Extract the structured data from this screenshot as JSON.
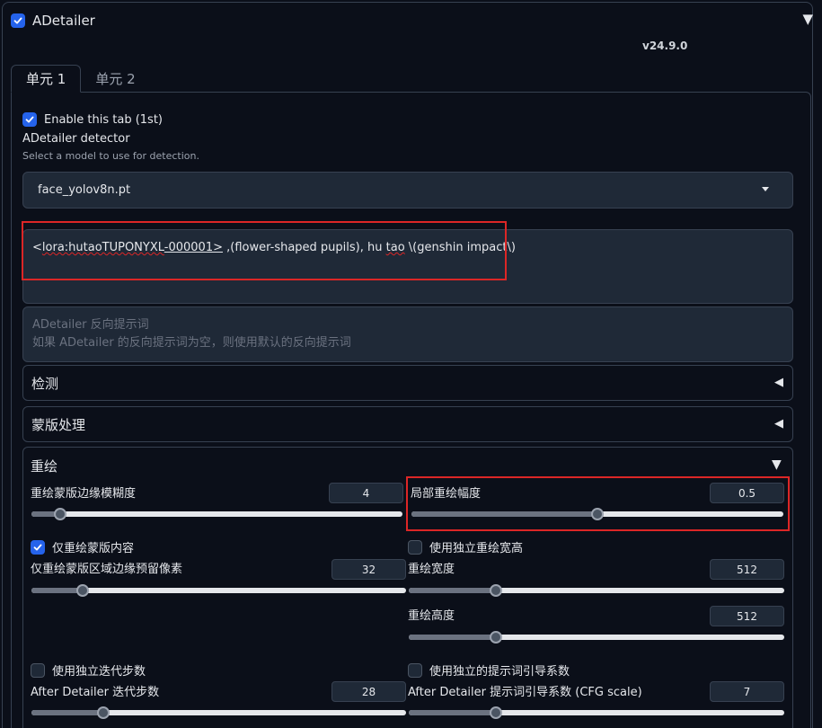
{
  "header": {
    "title": "ADetailer",
    "enabled": true,
    "version": "v24.9.0"
  },
  "tabs": [
    {
      "label": "单元 1",
      "active": true
    },
    {
      "label": "单元 2",
      "active": false
    }
  ],
  "unit": {
    "enable_label": "Enable this tab (1st)",
    "enable_checked": true,
    "detector_label": "ADetailer detector",
    "detector_sub": "Select a model to use for detection.",
    "detector_value": "face_yolov8n.pt",
    "prompt": {
      "part1": "<",
      "link": "lora:hutaoTUPONYXL",
      "part2": "-000001>",
      "part3": " ,(flower-shaped pupils), hu ",
      "tao": "tao",
      "part4": " \\(genshin impact\\)"
    },
    "neg_prompt_placeholder_1": "ADetailer 反向提示词",
    "neg_prompt_placeholder_2": "如果 ADetailer 的反向提示词为空，则使用默认的反向提示词"
  },
  "accordions": {
    "detect": "检测",
    "mask": "蒙版处理",
    "inpaint": "重绘"
  },
  "inpaint": {
    "mask_blur": {
      "label": "重绘蒙版边缘模糊度",
      "value": 4,
      "min": 0,
      "max": 64
    },
    "denoise": {
      "label": "局部重绘幅度",
      "value": "0.5",
      "fraction": 0.5
    },
    "only_masked": {
      "label": "仅重绘蒙版内容",
      "checked": true
    },
    "use_sep_wh": {
      "label": "使用独立重绘宽高",
      "checked": false
    },
    "padding": {
      "label": "仅重绘蒙版区域边缘预留像素",
      "value": 32,
      "min": 0,
      "max": 256
    },
    "width": {
      "label": "重绘宽度",
      "value": 512,
      "fraction": 0.23
    },
    "height": {
      "label": "重绘高度",
      "value": 512,
      "fraction": 0.23
    },
    "use_sep_steps": {
      "label": "使用独立迭代步数",
      "checked": false
    },
    "use_sep_cfg": {
      "label": "使用独立的提示词引导系数",
      "checked": false
    },
    "steps": {
      "label": "After Detailer 迭代步数",
      "value": 28,
      "fraction": 0.19
    },
    "cfg": {
      "label": "After Detailer 提示词引导系数 (CFG scale)",
      "value": 7,
      "fraction": 0.23
    }
  },
  "colors": {
    "accent": "#2563eb",
    "highlight": "#dc2626",
    "background": "#0b0f19"
  }
}
